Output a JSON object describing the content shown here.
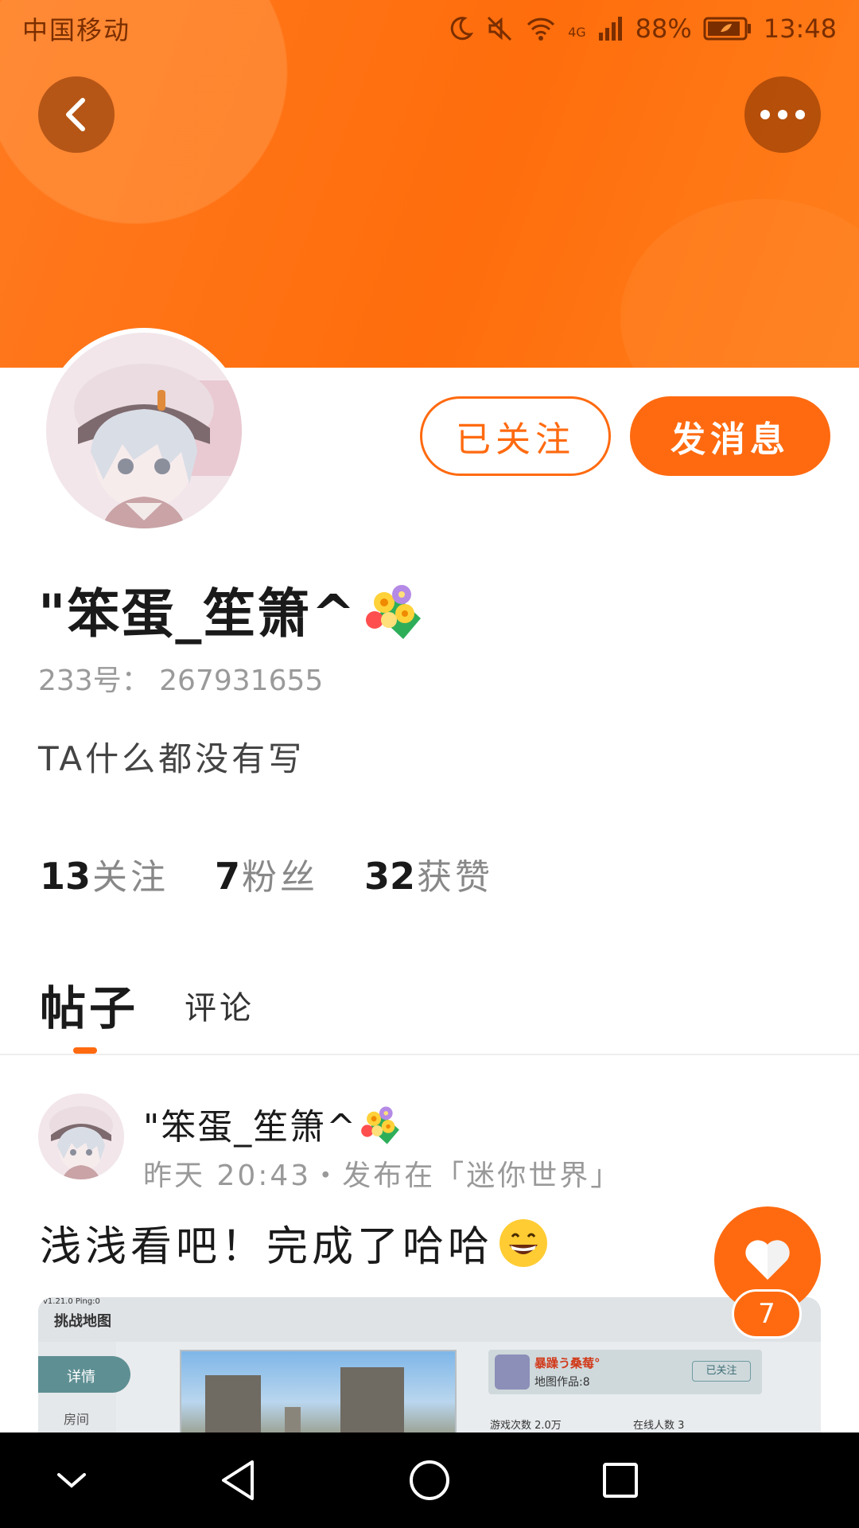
{
  "status_bar": {
    "carrier": "中国移动",
    "network": "4G",
    "battery": "88%",
    "time": "13:48",
    "icons": [
      "moon-icon",
      "mute-icon",
      "wifi-icon",
      "signal-icon",
      "battery-icon"
    ]
  },
  "header": {
    "back_icon": "chevron-left-icon",
    "more_icon": "more-dots-icon",
    "colors": {
      "accent": "#ff6a10",
      "header_bg": "#ff7a1f"
    }
  },
  "profile": {
    "followed_label": "已关注",
    "message_label": "发消息",
    "username": "\"笨蛋_笙箫^",
    "uid": "233号：  267931655",
    "bio": "TA什么都没有写",
    "stats": [
      {
        "num": "13",
        "label": "关注"
      },
      {
        "num": "7",
        "label": "粉丝"
      },
      {
        "num": "32",
        "label": "获赞"
      }
    ]
  },
  "tabs": {
    "posts": "帖子",
    "comments": "评论"
  },
  "post": {
    "author": "\"笨蛋_笙箫^",
    "meta": "昨天 20:43・发布在「迷你世界」",
    "text": "浅浅看吧！完成了哈哈",
    "image": {
      "title": "挑战地图",
      "tiny": "v1.21.0  Ping:0",
      "tab_details": "详情",
      "tab_room": "房间",
      "card_name": "暴躁う桑莓°",
      "card_works": "地图作品:8",
      "card_follow": "已关注",
      "play_count": "游戏次数  2.0万",
      "online": "在线人数  3"
    },
    "like_count": "7"
  },
  "nav": {
    "icons": [
      "collapse-icon",
      "back-triangle-icon",
      "home-circle-icon",
      "recents-square-icon"
    ]
  }
}
